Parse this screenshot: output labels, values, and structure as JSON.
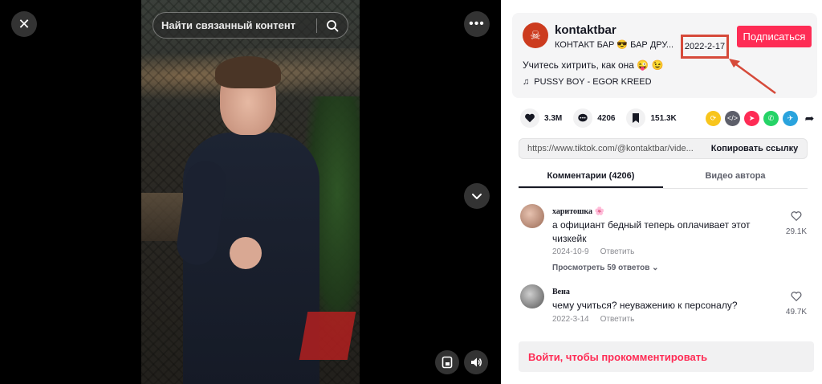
{
  "search": {
    "placeholder": "Найти связанный контент"
  },
  "author": {
    "username": "kontaktbar",
    "nickname": "КОНТАКТ БАР 😎 БАР ДРУ...",
    "post_date": "2022-2-17",
    "follow_label": "Подписаться",
    "caption": "Учитесь хитрить, как она 😜 😉",
    "music": "PUSSY BOY - EGOR KREED"
  },
  "stats": {
    "likes": "3.3M",
    "comments": "4206",
    "saves": "151.3K"
  },
  "share": {
    "link": "https://www.tiktok.com/@kontaktbar/vide...",
    "copy_label": "Копировать ссылку"
  },
  "tabs": [
    {
      "label": "Комментарии (4206)"
    },
    {
      "label": "Видео автора"
    }
  ],
  "comments": [
    {
      "author": "харитошка 🌸",
      "text": "а официант бедный теперь оплачивает этот чизкейк",
      "date": "2024-10-9",
      "reply_label": "Ответить",
      "view_replies": "Просмотреть 59 ответов",
      "likes": "29.1K"
    },
    {
      "author": "Вена",
      "text": "чему учиться? неуважению к персоналу?",
      "date": "2022-3-14",
      "reply_label": "Ответить",
      "likes": "49.7K"
    }
  ],
  "login_prompt": "Войти, чтобы прокомментировать",
  "colors": {
    "accent": "#fe2c55",
    "highlight_box": "#d64a3a"
  }
}
